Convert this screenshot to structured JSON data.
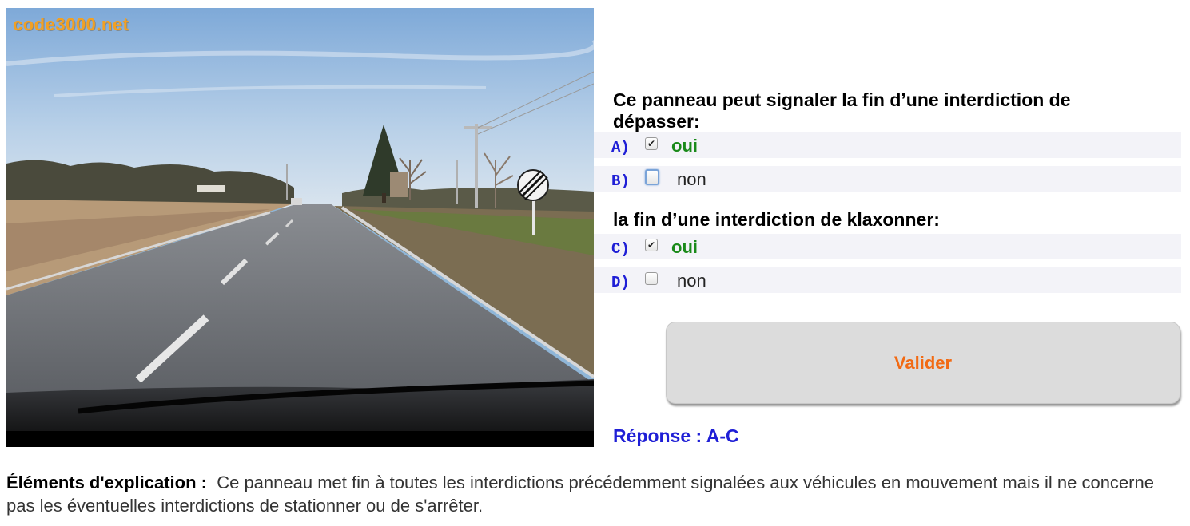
{
  "photo": {
    "watermark": "code3000.net"
  },
  "questions": [
    {
      "title": "Ce panneau peut signaler la fin d’une interdiction de dépasser:",
      "options": [
        {
          "letter": "A)",
          "label": "oui",
          "checked": true,
          "correct": true
        },
        {
          "letter": "B)",
          "label": "non",
          "checked": false,
          "correct": false
        }
      ]
    },
    {
      "title": "la fin d’une interdiction de klaxonner:",
      "options": [
        {
          "letter": "C)",
          "label": "oui",
          "checked": true,
          "correct": true
        },
        {
          "letter": "D)",
          "label": "non",
          "checked": false,
          "correct": false
        }
      ]
    }
  ],
  "validate_label": "Valider",
  "response": "Réponse : A-C",
  "explanation": {
    "label": "Éléments d'explication :",
    "text": "Ce panneau met fin à toutes les interdictions précédemment signalées aux véhicules en mouvement mais il ne concerne pas les éventuelles interdictions de stationner ou de s'arrêter."
  },
  "colors": {
    "option_letter": "#1f1fd6",
    "correct_answer": "#1a8a1a",
    "validate_text": "#f26a13",
    "response_text": "#1f1fd6",
    "watermark": "#f2a023"
  }
}
